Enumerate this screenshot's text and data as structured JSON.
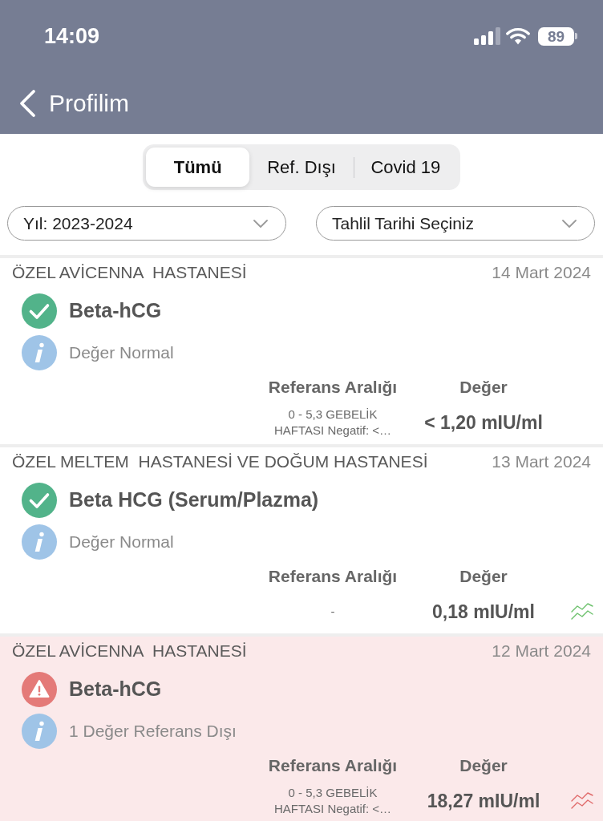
{
  "status_bar": {
    "time": "14:09",
    "battery": "89"
  },
  "nav": {
    "back_label": "Profilim"
  },
  "tabs": [
    {
      "label": "Tümü",
      "selected": true
    },
    {
      "label": "Ref. Dışı",
      "selected": false
    },
    {
      "label": "Covid 19",
      "selected": false
    }
  ],
  "filters": [
    {
      "value": "Yıl: 2023-2024"
    },
    {
      "value": "Tahlil Tarihi Seçiniz"
    }
  ],
  "results": [
    {
      "hospital": "ÖZEL AVİCENNA  HASTANESİ",
      "date": "14 Mart 2024",
      "test": "Beta-hCG",
      "out_of_range": false,
      "note": "Değer Normal",
      "reference_heading": "Referans Aralığı",
      "value_heading": "Değer",
      "reference": "0 - 5,3 GEBELİK HAFTASI Negatif: <…",
      "value": "< 1,20 mIU/ml",
      "trend_icon": false
    },
    {
      "hospital": "ÖZEL MELTEM  HASTANESİ VE DOĞUM HASTANESİ",
      "date": "13 Mart 2024",
      "test": "Beta HCG (Serum/Plazma)",
      "out_of_range": false,
      "note": "Değer Normal",
      "reference_heading": "Referans Aralığı",
      "value_heading": "Değer",
      "reference": "-",
      "value": "0,18 mIU/ml",
      "trend_icon": true
    },
    {
      "hospital": "ÖZEL AVİCENNA  HASTANESİ",
      "date": "12 Mart 2024",
      "test": "Beta-hCG",
      "out_of_range": true,
      "note": "1 Değer Referans Dışı",
      "reference_heading": "Referans Aralığı",
      "value_heading": "Değer",
      "reference": "0 - 5,3 GEBELİK HAFTASI Negatif: <…",
      "value": "18,27 mIU/ml",
      "trend_icon": true
    }
  ]
}
